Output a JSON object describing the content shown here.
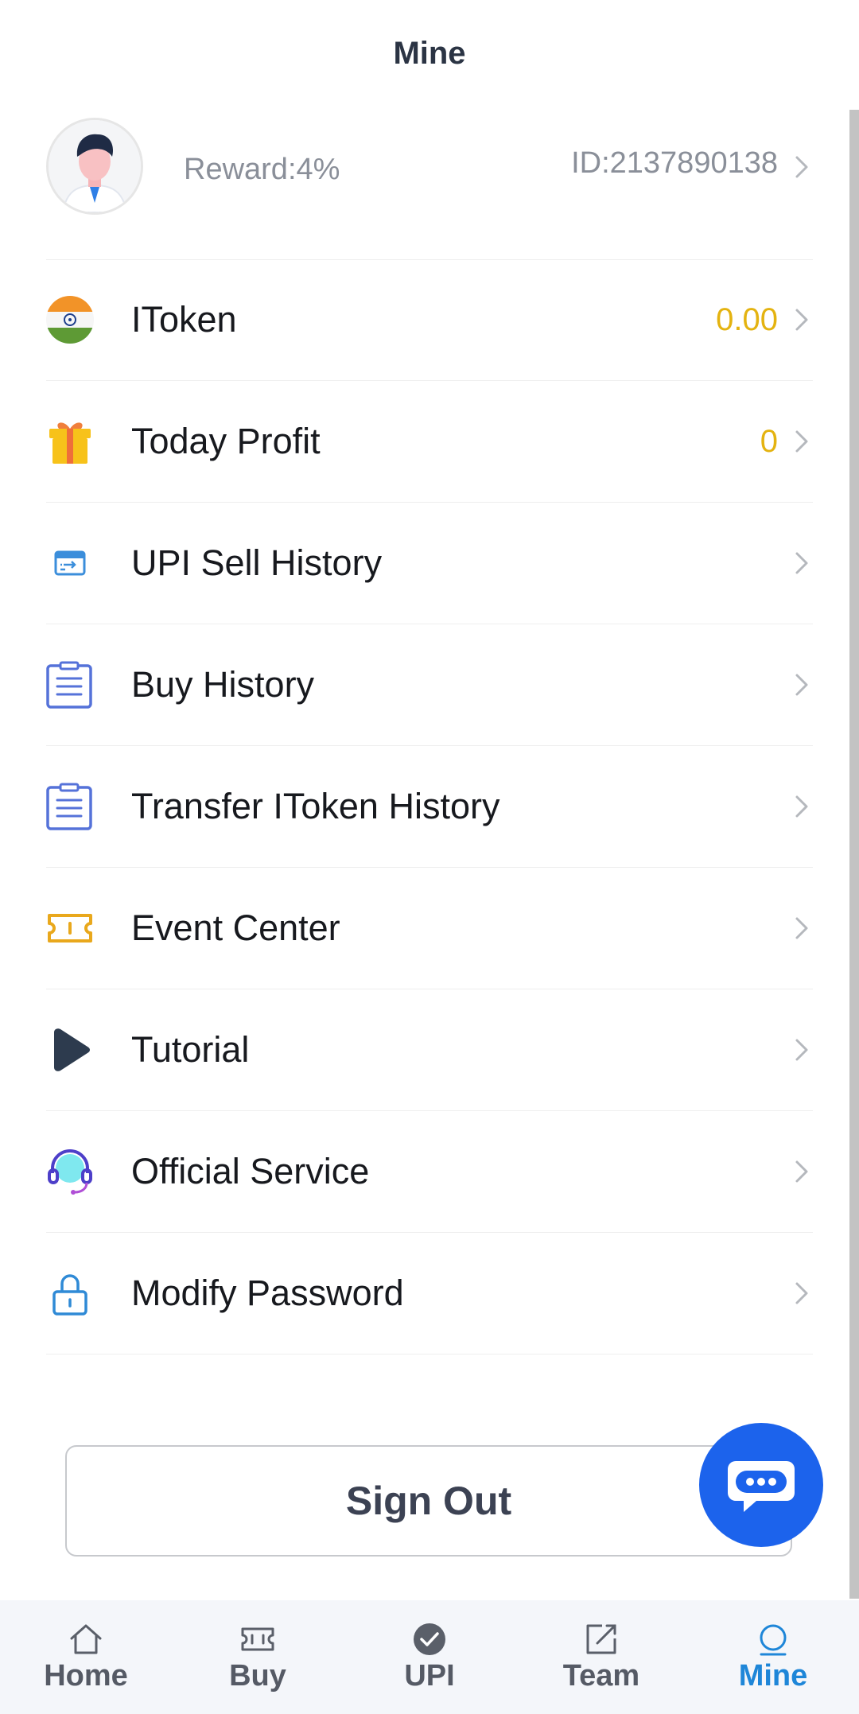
{
  "header": {
    "title": "Mine"
  },
  "profile": {
    "reward": "Reward:4%",
    "id": "ID:2137890138"
  },
  "menu": [
    {
      "label": "IToken",
      "value": "0.00",
      "icon": "india-flag-icon"
    },
    {
      "label": "Today Profit",
      "value": "0",
      "icon": "gift-icon"
    },
    {
      "label": "UPI Sell History",
      "value": "",
      "icon": "upi-box-icon"
    },
    {
      "label": "Buy History",
      "value": "",
      "icon": "clipboard-icon"
    },
    {
      "label": "Transfer IToken History",
      "value": "",
      "icon": "clipboard-icon"
    },
    {
      "label": "Event Center",
      "value": "",
      "icon": "ticket-icon"
    },
    {
      "label": "Tutorial",
      "value": "",
      "icon": "play-icon"
    },
    {
      "label": "Official Service",
      "value": "",
      "icon": "headset-icon"
    },
    {
      "label": "Modify Password",
      "value": "",
      "icon": "lock-icon"
    }
  ],
  "signout": {
    "label": "Sign Out"
  },
  "tabs": [
    {
      "label": "Home",
      "icon": "home-icon",
      "active": false
    },
    {
      "label": "Buy",
      "icon": "ticket-icon",
      "active": false
    },
    {
      "label": "UPI",
      "icon": "check-circle-icon",
      "active": false
    },
    {
      "label": "Team",
      "icon": "edit-icon",
      "active": false
    },
    {
      "label": "Mine",
      "icon": "person-circle-icon",
      "active": true
    }
  ],
  "colors": {
    "accent_blue": "#1e86d8",
    "fab_blue": "#1c63ec",
    "value_gold": "#e4b310"
  }
}
